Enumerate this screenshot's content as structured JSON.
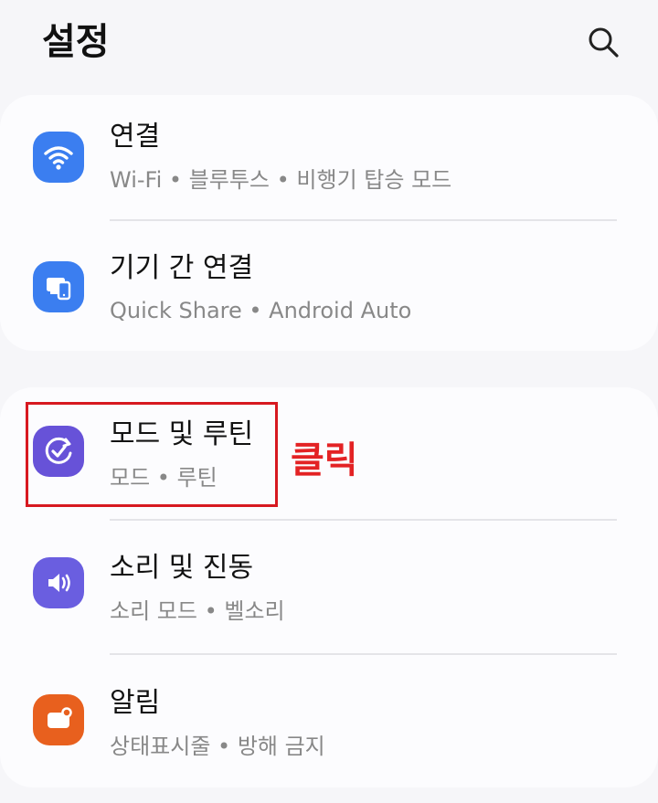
{
  "header": {
    "title": "설정"
  },
  "sections": [
    {
      "items": [
        {
          "title": "연결",
          "subtitle": "Wi-Fi  •  블루투스  •  비행기 탑승 모드",
          "icon": "wifi-icon",
          "icon_color": "#3b7ef0"
        },
        {
          "title": "기기 간 연결",
          "subtitle": "Quick Share  •  Android Auto",
          "icon": "devices-icon",
          "icon_color": "#3b7ef0"
        }
      ]
    },
    {
      "items": [
        {
          "title": "모드 및 루틴",
          "subtitle": "모드  •  루틴",
          "icon": "routine-check-icon",
          "icon_color": "#6752d8"
        },
        {
          "title": "소리 및 진동",
          "subtitle": "소리 모드  •  벨소리",
          "icon": "volume-icon",
          "icon_color": "#6a5ee0"
        },
        {
          "title": "알림",
          "subtitle": "상태표시줄  •  방해 금지",
          "icon": "notification-icon",
          "icon_color": "#e8601e"
        }
      ]
    }
  ],
  "annotation": {
    "label": "클릭",
    "color": "#e32224"
  }
}
